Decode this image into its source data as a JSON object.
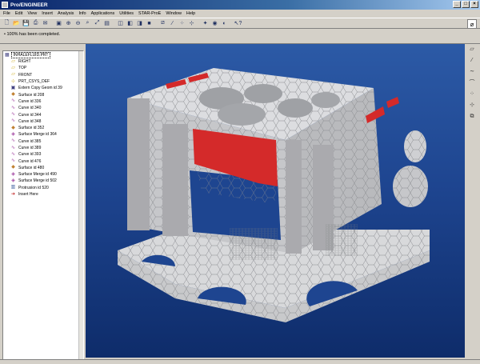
{
  "window": {
    "title": "Pro/ENGINEER",
    "minimize": "_",
    "maximize": "□",
    "close": "×"
  },
  "menu": [
    "File",
    "Edit",
    "View",
    "Insert",
    "Analysis",
    "Info",
    "Applications",
    "Utilities",
    "STAR-ProE",
    "Window",
    "Help"
  ],
  "message": "• 100% has been completed.",
  "tree": {
    "root": "INHALEFLUID.PRT",
    "items": [
      {
        "label": "RIGHT",
        "icon": "datum-plane-icon",
        "glyph": "▱",
        "color": "#c8a000"
      },
      {
        "label": "TOP",
        "icon": "datum-plane-icon",
        "glyph": "▱",
        "color": "#c8a000"
      },
      {
        "label": "FRONT",
        "icon": "datum-plane-icon",
        "glyph": "▱",
        "color": "#c8a000"
      },
      {
        "label": "PRT_CSYS_DEF",
        "icon": "csys-icon",
        "glyph": "⊹",
        "color": "#c8a000"
      },
      {
        "label": "Extern Copy Geom id 39",
        "icon": "copy-geom-icon",
        "glyph": "▣",
        "color": "#404080"
      },
      {
        "label": "Surface id 208",
        "icon": "surface-icon",
        "glyph": "◆",
        "color": "#c08030"
      },
      {
        "label": "Curve id 336",
        "icon": "curve-icon",
        "glyph": "∿",
        "color": "#a040a0"
      },
      {
        "label": "Curve id 340",
        "icon": "curve-icon",
        "glyph": "∿",
        "color": "#a040a0"
      },
      {
        "label": "Curve id 344",
        "icon": "curve-icon",
        "glyph": "∿",
        "color": "#a040a0"
      },
      {
        "label": "Curve id 348",
        "icon": "curve-icon",
        "glyph": "∿",
        "color": "#a040a0"
      },
      {
        "label": "Surface id 352",
        "icon": "surface-icon",
        "glyph": "◆",
        "color": "#c08030"
      },
      {
        "label": "Surface Merge id 364",
        "icon": "merge-icon",
        "glyph": "◈",
        "color": "#a040a0"
      },
      {
        "label": "Curve id 385",
        "icon": "curve-icon",
        "glyph": "∿",
        "color": "#a040a0"
      },
      {
        "label": "Curve id 389",
        "icon": "curve-icon",
        "glyph": "∿",
        "color": "#a040a0"
      },
      {
        "label": "Curve id 393",
        "icon": "curve-icon",
        "glyph": "∿",
        "color": "#a040a0"
      },
      {
        "label": "Curve id 476",
        "icon": "curve-icon",
        "glyph": "∿",
        "color": "#a040a0"
      },
      {
        "label": "Surface id 480",
        "icon": "surface-icon",
        "glyph": "◆",
        "color": "#c08030"
      },
      {
        "label": "Surface Merge id 490",
        "icon": "merge-icon",
        "glyph": "◈",
        "color": "#a040a0"
      },
      {
        "label": "Surface Merge id 502",
        "icon": "merge-icon",
        "glyph": "◈",
        "color": "#a040a0"
      },
      {
        "label": "Protrusion id 520",
        "icon": "protrusion-icon",
        "glyph": "▥",
        "color": "#4060a0"
      },
      {
        "label": "Insert Here",
        "icon": "insert-arrow-icon",
        "glyph": "➔",
        "color": "#c02020"
      }
    ]
  },
  "colors": {
    "viewport_top": "#2c5aa6",
    "viewport_bottom": "#0e2c6a",
    "highlight_red": "#d42a2a",
    "mesh_gray": "#c9cacb"
  }
}
